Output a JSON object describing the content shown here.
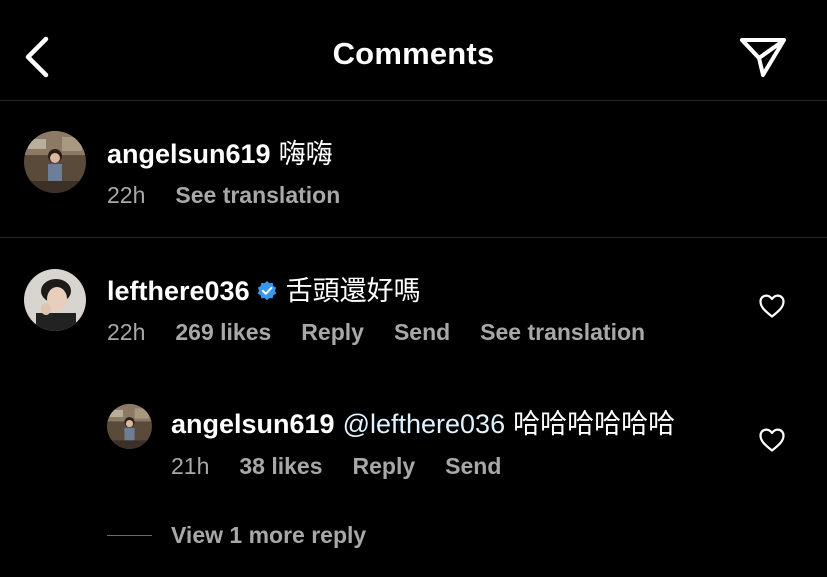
{
  "header": {
    "title": "Comments",
    "back_icon": "chevron-left-icon",
    "send_icon": "paper-plane-icon"
  },
  "comments": [
    {
      "username": "angelsun619",
      "text": "嗨嗨",
      "time": "22h",
      "actions": {
        "translate": "See translation"
      }
    },
    {
      "username": "lefthere036",
      "verified": true,
      "text": "舌頭還好嗎",
      "time": "22h",
      "likes": "269 likes",
      "actions": {
        "reply": "Reply",
        "send": "Send",
        "translate": "See translation"
      }
    }
  ],
  "reply": {
    "username": "angelsun619",
    "mention": "@lefthere036",
    "text": "哈哈哈哈哈哈",
    "time": "21h",
    "likes": "38 likes",
    "actions": {
      "reply": "Reply",
      "send": "Send"
    }
  },
  "view_more": "View 1 more reply",
  "colors": {
    "background": "#000000",
    "text": "#ffffff",
    "muted": "#a8a8a8",
    "divider": "#262626",
    "verified": "#3897f0"
  }
}
